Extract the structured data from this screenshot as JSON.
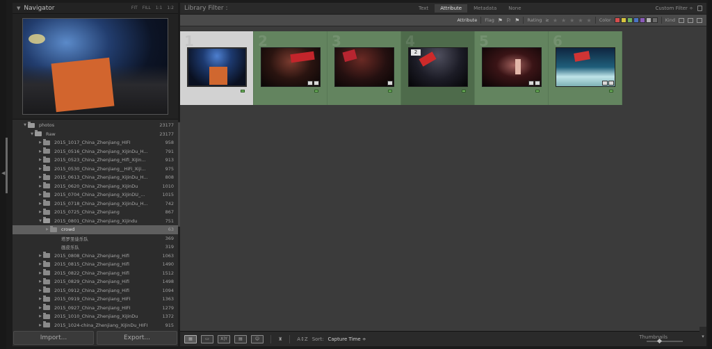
{
  "navigator": {
    "title": "Navigator",
    "zoom_options": [
      "FIT",
      "FILL",
      "1:1",
      "1:2"
    ]
  },
  "folders": [
    {
      "name": "photos",
      "count": "23177",
      "level": 0,
      "open": true
    },
    {
      "name": "Raw",
      "count": "23177",
      "level": 1,
      "open": true
    },
    {
      "name": "2015_1017_China_Zhenjiang_HIFI",
      "count": "958",
      "level": 2
    },
    {
      "name": "2015_0516_China_Zhenjiang_XiJinDu_H...",
      "count": "791",
      "level": 2
    },
    {
      "name": "2015_0523_China_Zhenjiang_Hifi_XiJin...",
      "count": "913",
      "level": 2
    },
    {
      "name": "2015_0530_China_Zhenjiang__HiFi_Xiji...",
      "count": "975",
      "level": 2
    },
    {
      "name": "2015_0613_China_Zhenjiang_XiJinDu_H...",
      "count": "808",
      "level": 2
    },
    {
      "name": "2015_0620_China_Zhenjiang_XiJinDu",
      "count": "1010",
      "level": 2
    },
    {
      "name": "2015_0704_China_Zhenjiang_XiJinDU_...",
      "count": "1015",
      "level": 2
    },
    {
      "name": "2015_0718_China_Zhenjiang_XiJinDu_H...",
      "count": "742",
      "level": 2
    },
    {
      "name": "2015_0725_China_Zhenjiang",
      "count": "867",
      "level": 2
    },
    {
      "name": "2015_0801_China_Zhenjiang_Xijindu",
      "count": "751",
      "level": 2,
      "open": true
    },
    {
      "name": "crowd",
      "count": "63",
      "level": 3,
      "selected": true
    },
    {
      "name": "塔罗圣徒乐队",
      "count": "369",
      "level": 3,
      "empty": true
    },
    {
      "name": "画皮乐队",
      "count": "319",
      "level": 3,
      "empty": true
    },
    {
      "name": "2015_0808_China_Zhenjiang_Hifi",
      "count": "1063",
      "level": 2
    },
    {
      "name": "2015_0815_China_Zhenjiang_Hifi",
      "count": "1490",
      "level": 2
    },
    {
      "name": "2015_0822_China_Zhenjiang_Hifi",
      "count": "1512",
      "level": 2
    },
    {
      "name": "2015_0829_China_Zhenjiang_Hifi",
      "count": "1498",
      "level": 2
    },
    {
      "name": "2015_0912_China_Zhenjiang_Hifi",
      "count": "1094",
      "level": 2
    },
    {
      "name": "2015_0919_China_Zhenjiang_HIFI",
      "count": "1363",
      "level": 2
    },
    {
      "name": "2015_0927_China_Zhenjiang_HIFI",
      "count": "1279",
      "level": 2
    },
    {
      "name": "2015_1010_China_Zhenjiang_XiJinDu",
      "count": "1372",
      "level": 2
    },
    {
      "name": "2015_1024-china_Zhenjiang_XiJinDu_HIFI",
      "count": "915",
      "level": 2
    }
  ],
  "buttons": {
    "import": "Import...",
    "export": "Export..."
  },
  "filter": {
    "title": "Library Filter :",
    "tabs": [
      "Text",
      "Attribute",
      "Metadata",
      "None"
    ],
    "active_tab": "Attribute",
    "preset": "Custom Filter ÷"
  },
  "attribute_bar": {
    "attribute": "Attribute",
    "flag": "Flag",
    "rating": "Rating",
    "rating_op": "≥",
    "color": "Color",
    "kind": "Kind",
    "swatches": [
      "#d74d4d",
      "#d8c43f",
      "#6fb35c",
      "#4a73c2",
      "#8a5ab8",
      "#b5b5b5",
      "#6a6a6a"
    ]
  },
  "grid": {
    "cells": [
      {
        "num": "1",
        "class": "first",
        "photo": "p1",
        "badges": 0
      },
      {
        "num": "2",
        "class": "",
        "photo": "p2",
        "badges": 2
      },
      {
        "num": "3",
        "class": "",
        "photo": "p3",
        "badges": 1
      },
      {
        "num": "4",
        "class": "dark",
        "photo": "p4",
        "badges": 0,
        "stack": "2"
      },
      {
        "num": "5",
        "class": "",
        "photo": "p5",
        "badges": 2
      },
      {
        "num": "6",
        "class": "",
        "photo": "p6",
        "badges": 2
      }
    ]
  },
  "toolbar": {
    "sort_label": "Sort:",
    "sort_value": "Capture Time ÷",
    "thumbnails": "Thumbnails",
    "compare": "X|Y"
  }
}
